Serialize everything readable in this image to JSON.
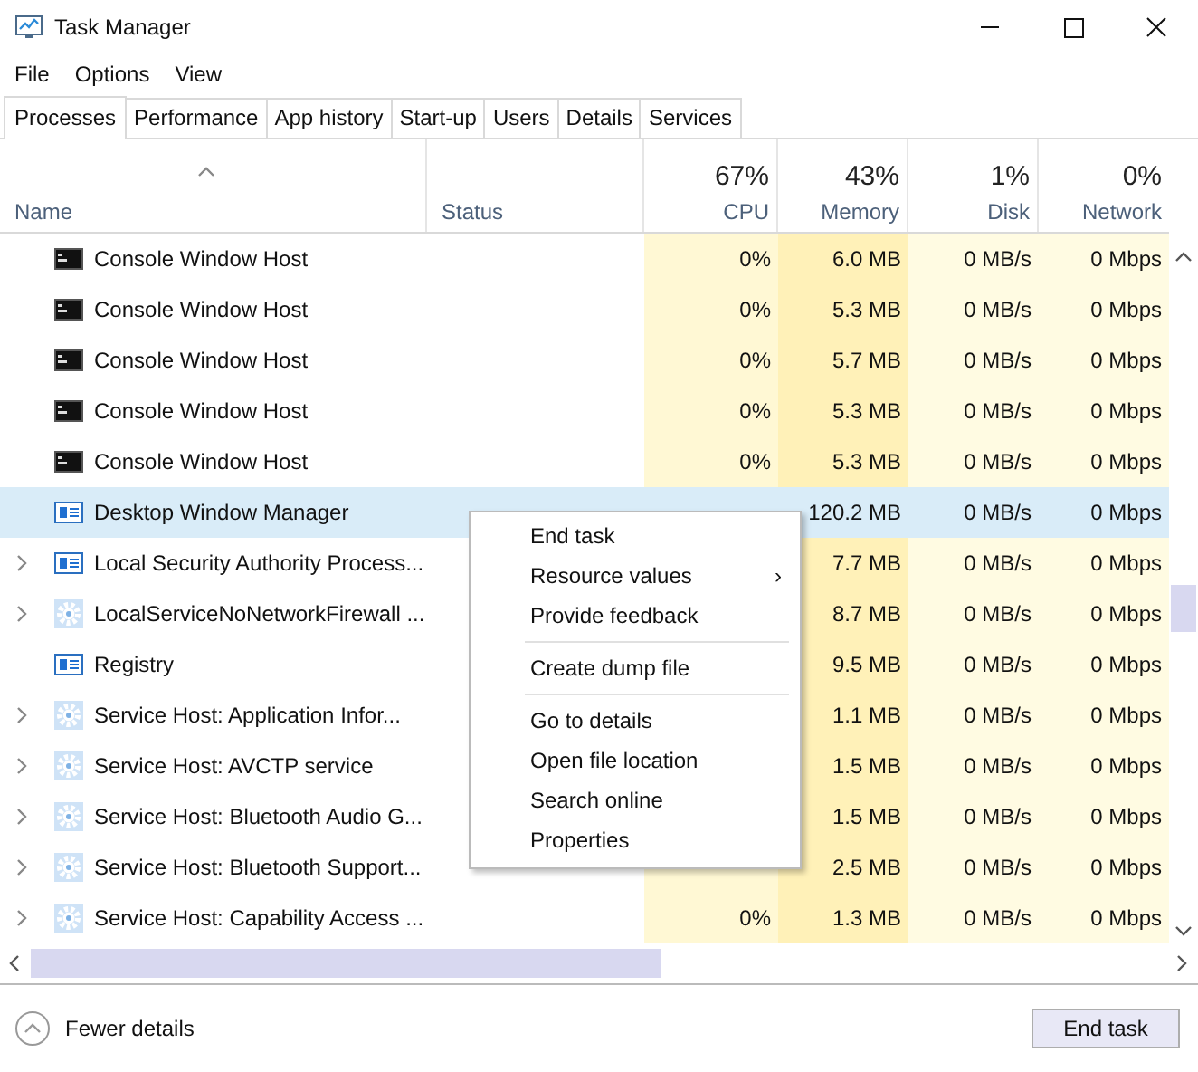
{
  "window": {
    "title": "Task Manager"
  },
  "menu": [
    "File",
    "Options",
    "View"
  ],
  "tabs": [
    {
      "label": "Processes",
      "selected": true
    },
    {
      "label": "Performance",
      "selected": false
    },
    {
      "label": "App history",
      "selected": false
    },
    {
      "label": "Start-up",
      "selected": false
    },
    {
      "label": "Users",
      "selected": false
    },
    {
      "label": "Details",
      "selected": false
    },
    {
      "label": "Services",
      "selected": false
    }
  ],
  "columns": [
    {
      "label": "Name"
    },
    {
      "label": "Status"
    },
    {
      "usage": "67%",
      "label": "CPU"
    },
    {
      "usage": "43%",
      "label": "Memory"
    },
    {
      "usage": "1%",
      "label": "Disk"
    },
    {
      "usage": "0%",
      "label": "Network"
    }
  ],
  "rows": [
    {
      "kind": "console",
      "name": "Console Window Host",
      "expandable": false,
      "selected": false,
      "cpu": "0%",
      "memory": "6.0 MB",
      "disk": "0 MB/s",
      "network": "0 Mbps"
    },
    {
      "kind": "console",
      "name": "Console Window Host",
      "expandable": false,
      "selected": false,
      "cpu": "0%",
      "memory": "5.3 MB",
      "disk": "0 MB/s",
      "network": "0 Mbps"
    },
    {
      "kind": "console",
      "name": "Console Window Host",
      "expandable": false,
      "selected": false,
      "cpu": "0%",
      "memory": "5.7 MB",
      "disk": "0 MB/s",
      "network": "0 Mbps"
    },
    {
      "kind": "console",
      "name": "Console Window Host",
      "expandable": false,
      "selected": false,
      "cpu": "0%",
      "memory": "5.3 MB",
      "disk": "0 MB/s",
      "network": "0 Mbps"
    },
    {
      "kind": "console",
      "name": "Console Window Host",
      "expandable": false,
      "selected": false,
      "cpu": "0%",
      "memory": "5.3 MB",
      "disk": "0 MB/s",
      "network": "0 Mbps"
    },
    {
      "kind": "window",
      "name": "Desktop Window Manager",
      "expandable": false,
      "selected": true,
      "memory": "120.2 MB",
      "disk": "0 MB/s",
      "network": "0 Mbps"
    },
    {
      "kind": "window",
      "name": "Local Security Authority Process...",
      "expandable": true,
      "selected": false,
      "memory": "7.7 MB",
      "disk": "0 MB/s",
      "network": "0 Mbps"
    },
    {
      "kind": "gear",
      "name": "LocalServiceNoNetworkFirewall ...",
      "expandable": true,
      "selected": false,
      "memory": "8.7 MB",
      "disk": "0 MB/s",
      "network": "0 Mbps"
    },
    {
      "kind": "window",
      "name": "Registry",
      "expandable": false,
      "selected": false,
      "memory": "9.5 MB",
      "disk": "0 MB/s",
      "network": "0 Mbps"
    },
    {
      "kind": "gear",
      "name": "Service Host: Application Infor...",
      "expandable": true,
      "selected": false,
      "memory": "1.1 MB",
      "disk": "0 MB/s",
      "network": "0 Mbps"
    },
    {
      "kind": "gear",
      "name": "Service Host: AVCTP service",
      "expandable": true,
      "selected": false,
      "memory": "1.5 MB",
      "disk": "0 MB/s",
      "network": "0 Mbps"
    },
    {
      "kind": "gear",
      "name": "Service Host: Bluetooth Audio G...",
      "expandable": true,
      "selected": false,
      "memory": "1.5 MB",
      "disk": "0 MB/s",
      "network": "0 Mbps"
    },
    {
      "kind": "gear",
      "name": "Service Host: Bluetooth Support...",
      "expandable": true,
      "selected": false,
      "memory": "2.5 MB",
      "disk": "0 MB/s",
      "network": "0 Mbps"
    },
    {
      "kind": "gear",
      "name": "Service Host: Capability Access ...",
      "expandable": true,
      "selected": false,
      "cpu": "0%",
      "memory": "1.3 MB",
      "disk": "0 MB/s",
      "network": "0 Mbps"
    }
  ],
  "context_menu": [
    {
      "kind": "item",
      "label": "End task"
    },
    {
      "kind": "submenu",
      "label": "Resource values",
      "arrow": "›"
    },
    {
      "kind": "item",
      "label": "Provide feedback"
    },
    {
      "kind": "separator"
    },
    {
      "kind": "item",
      "label": "Create dump file"
    },
    {
      "kind": "separator"
    },
    {
      "kind": "item",
      "label": "Go to details"
    },
    {
      "kind": "item",
      "label": "Open file location"
    },
    {
      "kind": "item",
      "label": "Search online"
    },
    {
      "kind": "item",
      "label": "Properties"
    }
  ],
  "footer": {
    "toggle": "Fewer details",
    "button": "End task"
  }
}
